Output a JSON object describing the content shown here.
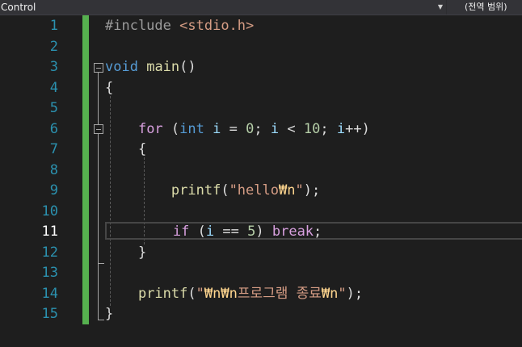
{
  "navbar": {
    "left_label": "Control",
    "right_label": "(전역 범위)"
  },
  "gutter": {
    "line_numbers": [
      "1",
      "2",
      "3",
      "4",
      "5",
      "6",
      "7",
      "8",
      "9",
      "10",
      "11",
      "12",
      "13",
      "14",
      "15"
    ],
    "current_line": "11"
  },
  "code": {
    "line1": {
      "directive": "#include",
      "header": "<stdio.h>"
    },
    "line3": {
      "type": "void",
      "name": "main",
      "parens": "()"
    },
    "line4": {
      "brace": "{"
    },
    "line6": {
      "kw_for": "for",
      "open": "(",
      "kw_int": "int",
      "var_i1": "i",
      "assign": "=",
      "zero": "0",
      "semi1": ";",
      "var_i2": "i",
      "lt": "<",
      "ten": "10",
      "semi2": ";",
      "var_i3": "i",
      "incr": "++",
      "close": ")"
    },
    "line7": {
      "brace": "{"
    },
    "line9": {
      "fn": "printf",
      "open": "(",
      "str_a": "\"hello",
      "esc": "₩n",
      "str_b": "\"",
      "close": ");"
    },
    "line11": {
      "kw_if": "if",
      "open": "(",
      "var_i": "i",
      "eq": "==",
      "five": "5",
      "close": ")",
      "kw_break": "break",
      "semi": ";"
    },
    "line12": {
      "brace": "}"
    },
    "line14": {
      "fn": "printf",
      "open": "(",
      "q1": "\"",
      "esc1": "₩n₩n",
      "text": "프로그램 종료",
      "esc2": "₩n",
      "q2": "\"",
      "close": ");"
    },
    "line15": {
      "brace": "}"
    }
  },
  "colors": {
    "background": "#1e1e1e",
    "line_number": "#2b91af",
    "keyword": "#569cd6",
    "control_keyword": "#d8a0df",
    "function": "#dcdcaa",
    "string": "#d69d85",
    "escape": "#ffd68f",
    "number": "#b5cea8",
    "variable": "#9cdcfe",
    "change_bar": "#56b04f"
  }
}
